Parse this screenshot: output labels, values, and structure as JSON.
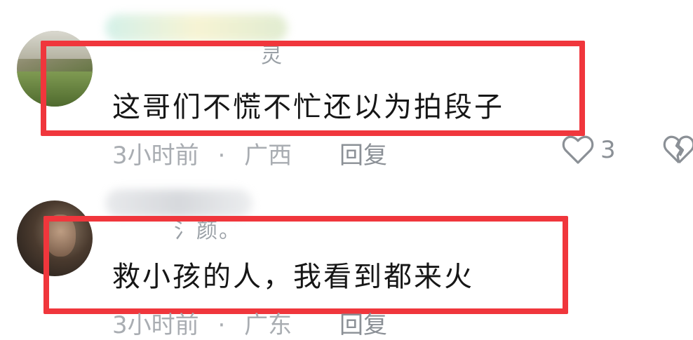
{
  "comments": [
    {
      "username_visible": "灵",
      "text": "这哥们不慌不忙还以为拍段子",
      "time": "3小时前",
      "separator": "·",
      "location": "广西",
      "reply_label": "回复",
      "like_count": "3"
    },
    {
      "username_visible": "氵颜。",
      "text": "救小孩的人，我看到都来火",
      "time": "3小时前",
      "separator": "·",
      "location": "广东",
      "reply_label": "回复"
    }
  ],
  "colors": {
    "highlight_frame": "#f0363c",
    "meta_text": "#a9adb2",
    "body_text": "#161616"
  },
  "icons": {
    "like": "heart-outline-icon",
    "dislike": "broken-heart-icon"
  }
}
